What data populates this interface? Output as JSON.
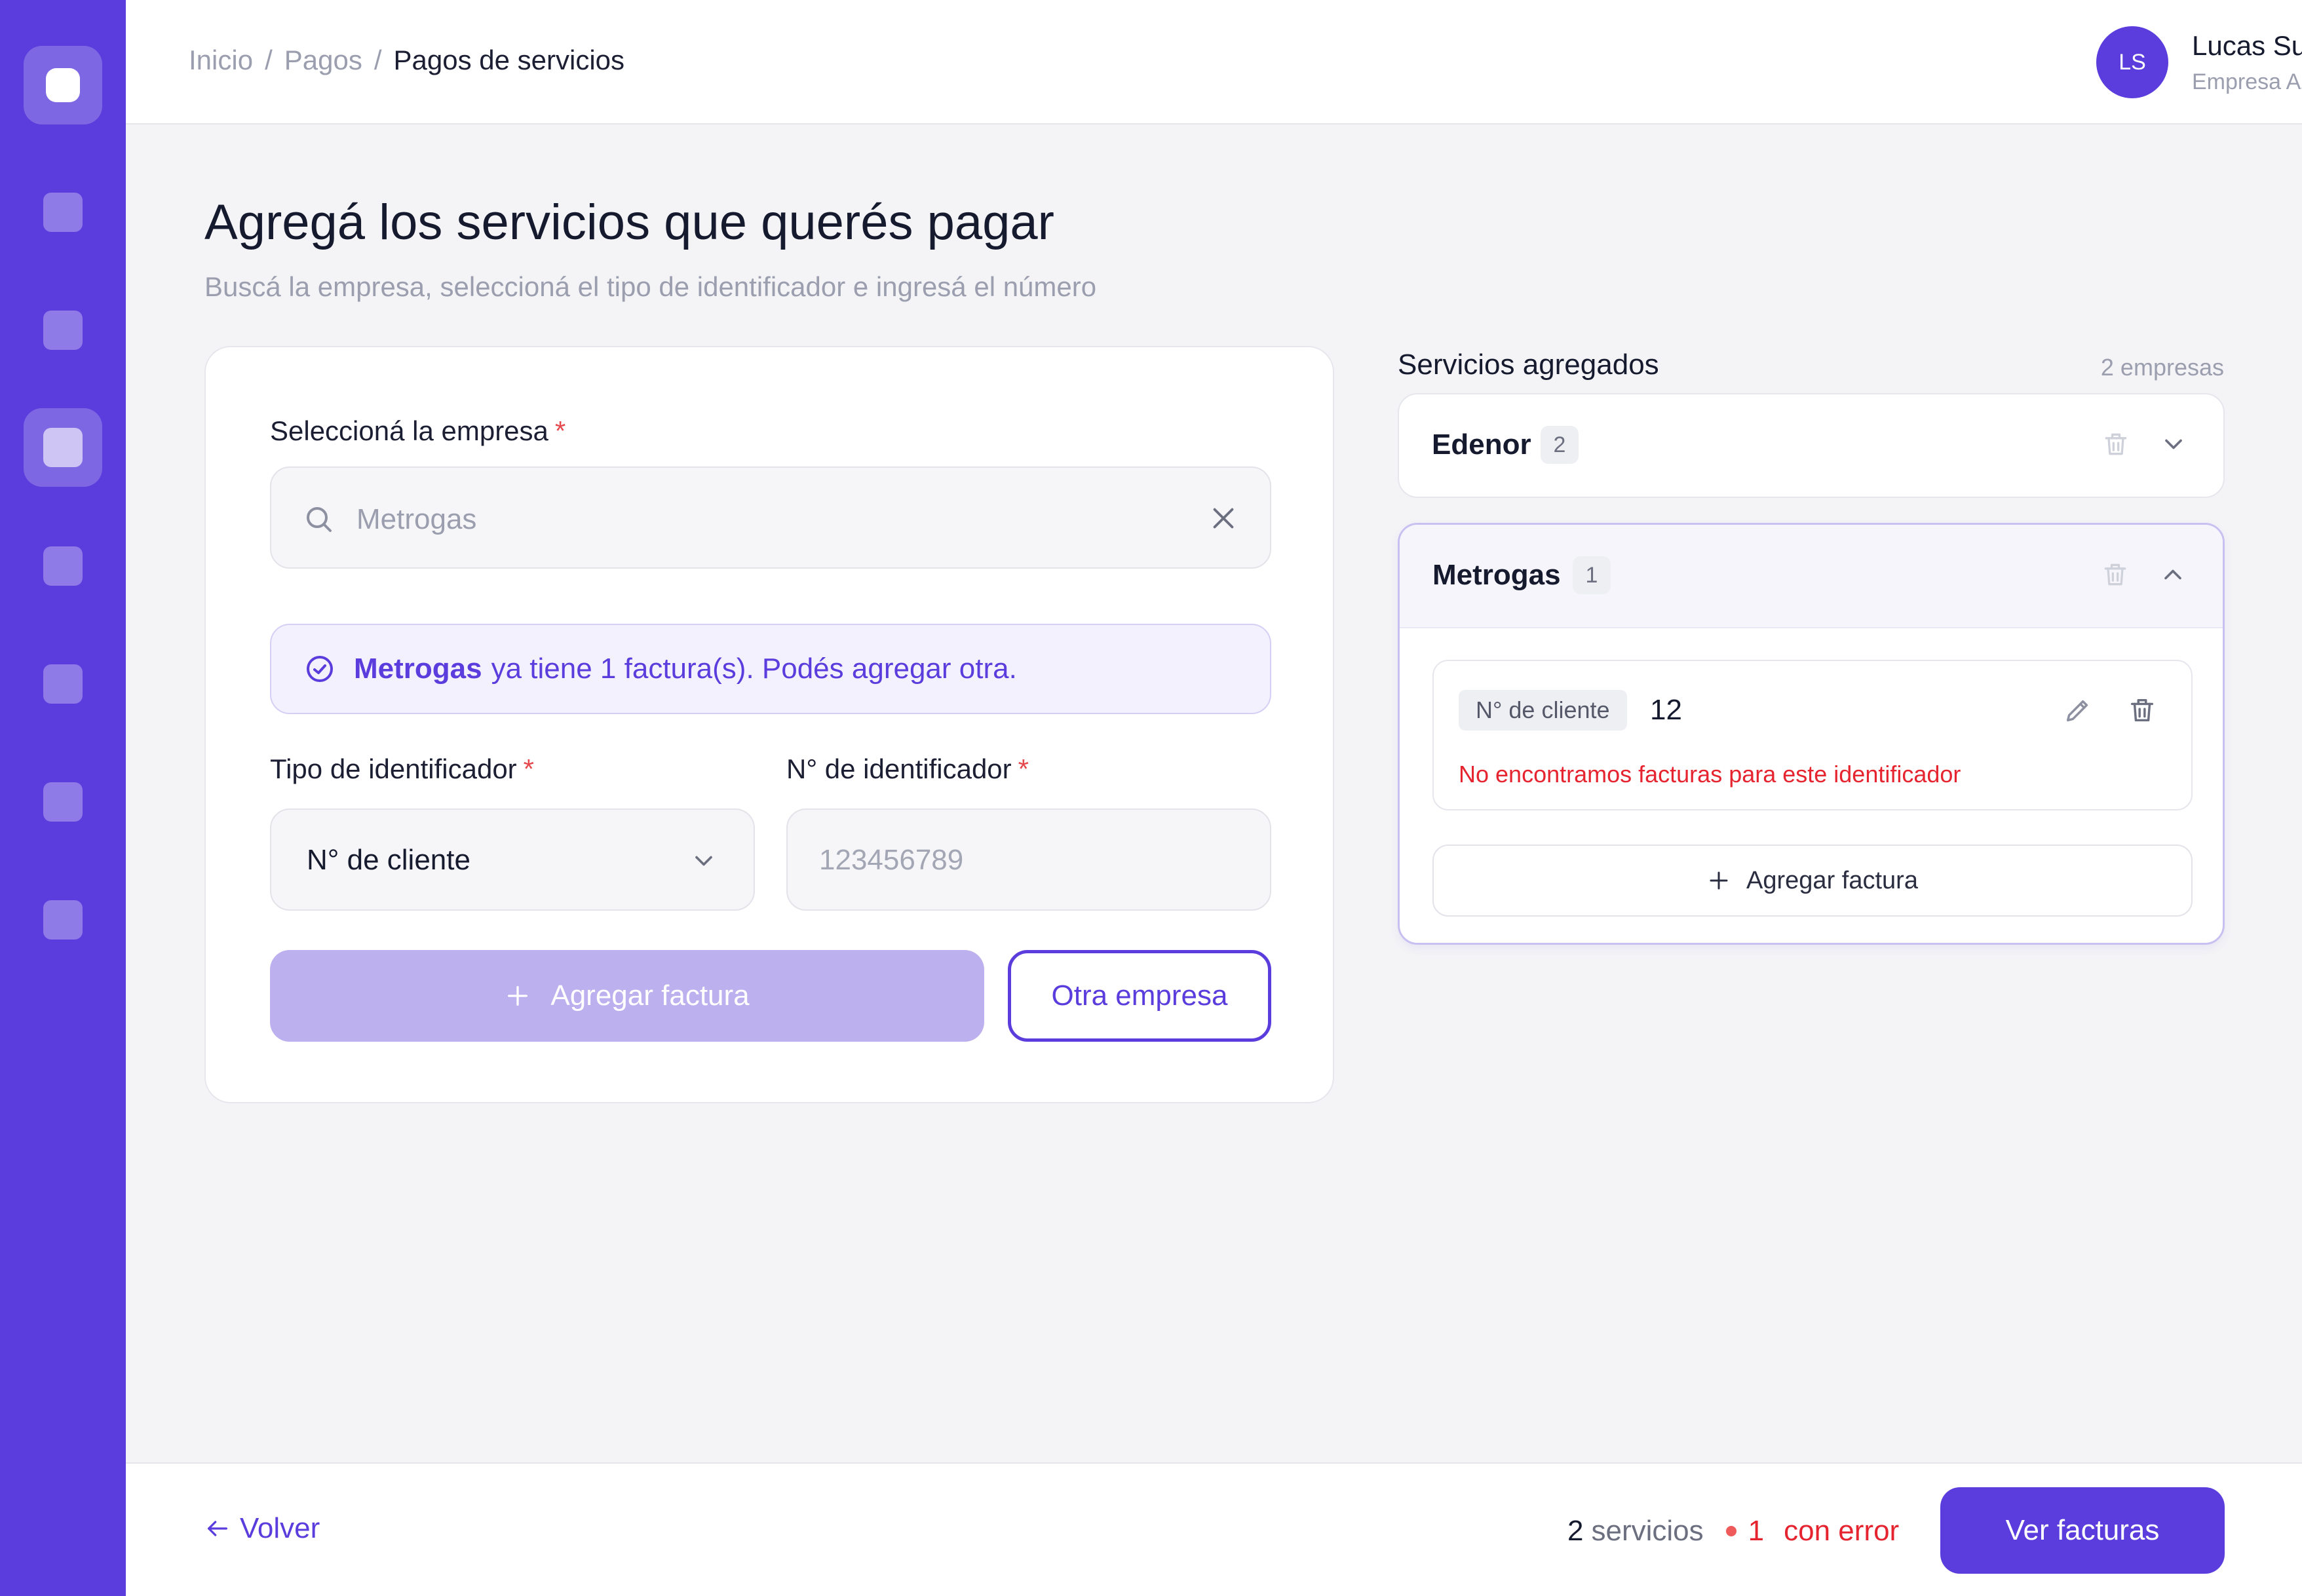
{
  "breadcrumb": {
    "items": [
      "Inicio",
      "Pagos"
    ],
    "separator": "/",
    "current": "Pagos de servicios"
  },
  "user": {
    "initials": "LS",
    "name": "Lucas Suárez",
    "company": "Empresa Azul"
  },
  "page": {
    "title": "Agregá los servicios que querés pagar",
    "subtitle": "Buscá la empresa, seleccioná el tipo de identificador e ingresá el número"
  },
  "form": {
    "company_label": "Seleccioná la empresa",
    "required_mark": "*",
    "company_search_value": "Metrogas",
    "notice": {
      "company": "Metrogas",
      "text": "ya tiene 1 factura(s). Podés agregar otra."
    },
    "id_type_label": "Tipo de identificador",
    "id_type_value": "N° de cliente",
    "id_number_label": "N° de identificador",
    "id_number_placeholder": "123456789",
    "add_button": "Agregar factura",
    "other_button": "Otra empresa"
  },
  "panel": {
    "title": "Servicios agregados",
    "count": "2 empresas",
    "services": [
      {
        "name": "Edenor",
        "count": "2",
        "expanded": false
      },
      {
        "name": "Metrogas",
        "count": "1",
        "expanded": true,
        "bills": [
          {
            "id_type": "N° de cliente",
            "id_value": "12",
            "error": "No encontramos facturas para este identificador"
          }
        ],
        "add_bill_label": "Agregar factura"
      }
    ]
  },
  "footer": {
    "back_label": "Volver",
    "services_count": "2",
    "services_label": "servicios",
    "error_count": "1",
    "error_label": "con error",
    "primary_button": "Ver facturas"
  },
  "colors": {
    "brand": "#5a3ddc",
    "error": "#e5242f",
    "disabled_button": "#bdb0ef",
    "background": "#f4f4f6"
  },
  "icons": [
    "search-icon",
    "close-icon",
    "check-circle-icon",
    "chevron-down-icon",
    "chevron-up-icon",
    "plus-icon",
    "trash-icon",
    "pencil-icon",
    "arrow-left-icon"
  ]
}
